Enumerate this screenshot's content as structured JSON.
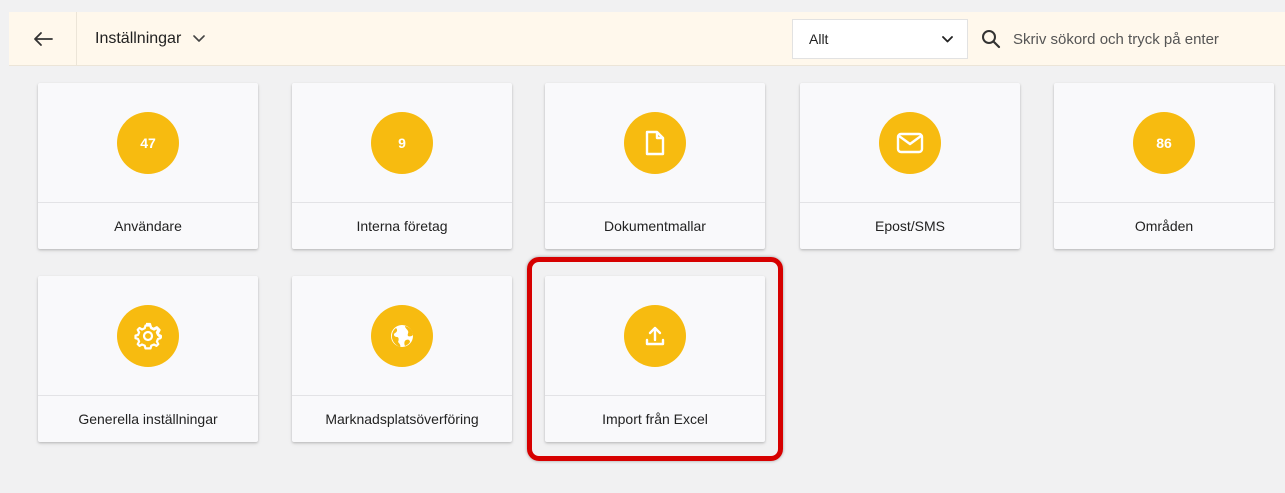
{
  "header": {
    "title": "Inställningar",
    "filter_value": "Allt",
    "search_placeholder": "Skriv sökord och tryck på enter"
  },
  "tiles": [
    {
      "label": "Användare",
      "badge": "47",
      "icon": "count-badge"
    },
    {
      "label": "Interna företag",
      "badge": "9",
      "icon": "count-badge"
    },
    {
      "label": "Dokumentmallar",
      "badge": "",
      "icon": "document-icon"
    },
    {
      "label": "Epost/SMS",
      "badge": "",
      "icon": "envelope-icon"
    },
    {
      "label": "Områden",
      "badge": "86",
      "icon": "count-badge"
    },
    {
      "label": "Generella inställningar",
      "badge": "",
      "icon": "gear-icon"
    },
    {
      "label": "Marknadsplatsöverföring",
      "badge": "",
      "icon": "globe-icon"
    },
    {
      "label": "Import från Excel",
      "badge": "",
      "icon": "upload-icon"
    }
  ],
  "colors": {
    "accent": "#f7bb10",
    "header_bg": "#fff8ec",
    "page_bg": "#f1f1f2",
    "highlight": "#d60000"
  }
}
